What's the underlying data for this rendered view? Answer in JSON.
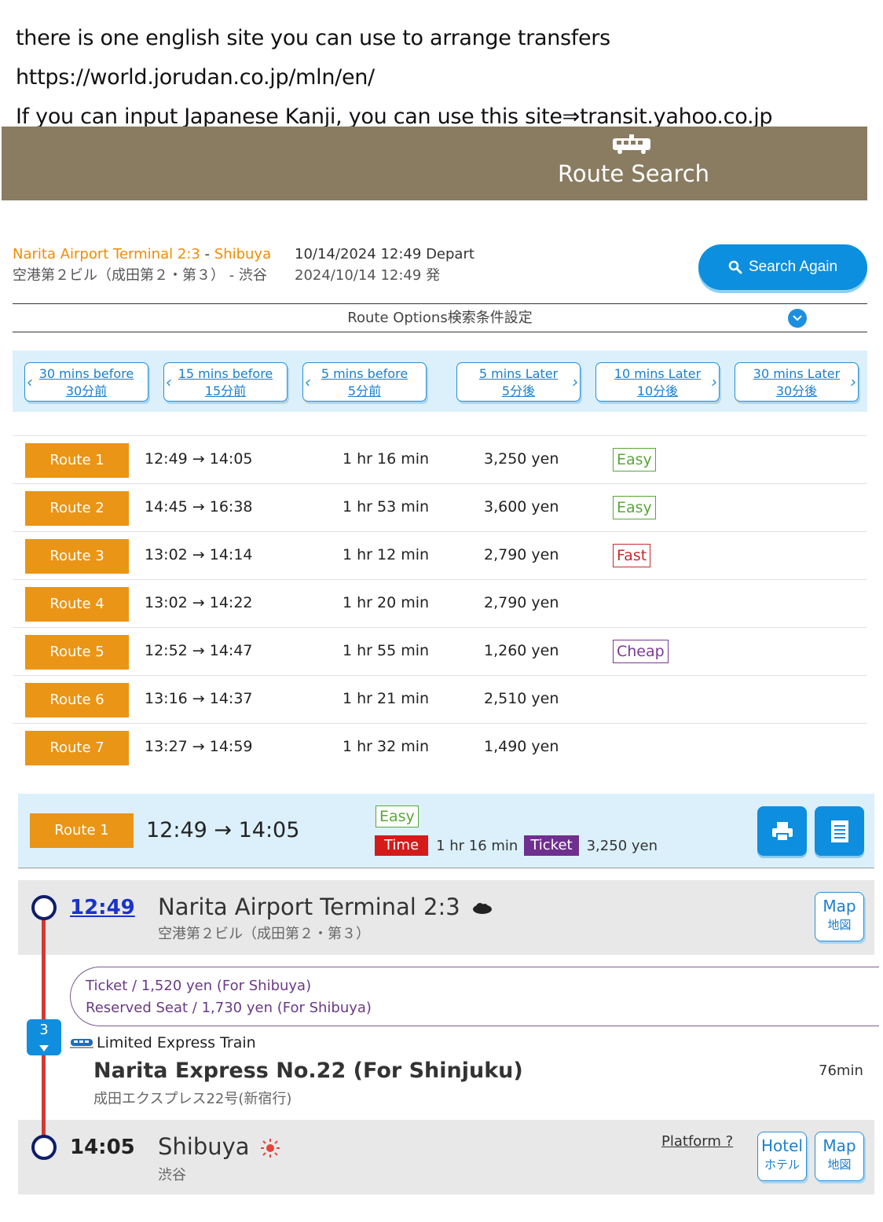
{
  "intro": {
    "line1": "there is one english site you can use to arrange transfers",
    "line2": "https://world.jorudan.co.jp/mln/en/",
    "line3": "If you can input Japanese Kanji, you can use this site⇒transit.yahoo.co.jp"
  },
  "header": {
    "title": "Route Search",
    "icon": "train-icon"
  },
  "search": {
    "from_en": "Narita Airport Terminal 2:3",
    "separator": " - ",
    "to_en": "Shibuya",
    "route_jp": "空港第２ビル（成田第２・第３） - 渋谷",
    "datetime_en": "10/14/2024 12:49 Depart",
    "datetime_jp": "2024/10/14 12:49 発",
    "search_again_label": "Search Again"
  },
  "route_options": {
    "label": "Route Options検索条件設定"
  },
  "time_shift": [
    {
      "en": "30 mins before",
      "jp": "30分前"
    },
    {
      "en": "15 mins before",
      "jp": "15分前"
    },
    {
      "en": "5 mins before",
      "jp": "5分前"
    },
    {
      "en": "5 mins Later",
      "jp": "5分後"
    },
    {
      "en": "10 mins Later",
      "jp": "10分後"
    },
    {
      "en": "30 mins Later",
      "jp": "30分後"
    }
  ],
  "routes": [
    {
      "label": "Route 1",
      "times": "12:49 → 14:05",
      "duration": "1 hr 16 min",
      "fare": "3,250 yen",
      "tag": "Easy"
    },
    {
      "label": "Route 2",
      "times": "14:45 → 16:38",
      "duration": "1 hr 53 min",
      "fare": "3,600 yen",
      "tag": "Easy"
    },
    {
      "label": "Route 3",
      "times": "13:02 → 14:14",
      "duration": "1 hr 12 min",
      "fare": "2,790 yen",
      "tag": "Fast"
    },
    {
      "label": "Route 4",
      "times": "13:02 → 14:22",
      "duration": "1 hr 20 min",
      "fare": "2,790 yen",
      "tag": ""
    },
    {
      "label": "Route 5",
      "times": "12:52 → 14:47",
      "duration": "1 hr 55 min",
      "fare": "1,260 yen",
      "tag": "Cheap"
    },
    {
      "label": "Route 6",
      "times": "13:16 → 14:37",
      "duration": "1 hr 21 min",
      "fare": "2,510 yen",
      "tag": ""
    },
    {
      "label": "Route 7",
      "times": "13:27 → 14:59",
      "duration": "1 hr 32 min",
      "fare": "1,490 yen",
      "tag": ""
    }
  ],
  "detail": {
    "label": "Route 1",
    "times": "12:49 → 14:05",
    "tag": "Easy",
    "time_label": "Time",
    "duration": "1 hr 16 min",
    "ticket_label": "Ticket",
    "fare": "3,250 yen",
    "print_icon": "printer-icon",
    "doc_icon": "document-icon",
    "departure": {
      "time": "12:49",
      "name": "Narita Airport Terminal 2:3",
      "name_jp": "空港第２ビル（成田第２・第３）",
      "weather_icon": "cloud-icon",
      "map_label": "Map",
      "map_label_jp": "地図"
    },
    "ticket_line": "Ticket / 1,520 yen (For Shibuya)",
    "seat_line": "Reserved Seat / 1,730 yen (For Shibuya)",
    "platform_number": "3",
    "train_type": "Limited Express Train",
    "train_name": "Narita Express No.22 (For Shinjuku)",
    "train_name_jp": "成田エクスプレス22号(新宿行)",
    "train_duration": "76min",
    "arrival": {
      "time": "14:05",
      "name": "Shibuya",
      "name_jp": "渋谷",
      "weather_icon": "sun-icon",
      "platform_link": "Platform ?",
      "hotel_label": "Hotel",
      "hotel_label_jp": "ホテル",
      "map_label": "Map",
      "map_label_jp": "地図"
    }
  },
  "colors": {
    "banner": "#8a7c61",
    "accent_blue": "#0b8fde",
    "route_orange": "#ea9516",
    "easy_green": "#5aa63a",
    "fast_red": "#c9282d",
    "cheap_purple": "#7a3a96",
    "line_red": "#d13a34"
  }
}
